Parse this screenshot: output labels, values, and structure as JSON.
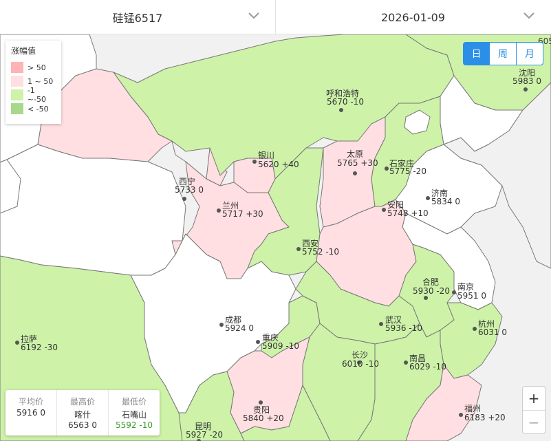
{
  "header": {
    "product": "硅锰6517",
    "date": "2026-01-09"
  },
  "legend": {
    "title": "涨幅值",
    "items": [
      {
        "label": "> 50",
        "color": "#ffb3b5"
      },
      {
        "label": "1 ~ 50",
        "color": "#ffdfe1"
      },
      {
        "label": "-1 ~-50",
        "color": "#cdf2a8"
      },
      {
        "label": "< -50",
        "color": "#a8d98a"
      }
    ]
  },
  "period_buttons": [
    {
      "label": "日",
      "active": true
    },
    {
      "label": "周",
      "active": false
    },
    {
      "label": "月",
      "active": false
    }
  ],
  "stats": {
    "avg": {
      "label": "平均价",
      "value": "5916 0"
    },
    "max": {
      "label": "最高价",
      "city": "喀什",
      "value": "6563 0"
    },
    "min": {
      "label": "最低价",
      "city": "石嘴山",
      "value": "5592 -10"
    }
  },
  "zoom": {
    "in": "+",
    "out": "−"
  },
  "edge_label": "605",
  "cities": [
    {
      "name": "沈阳",
      "value": "5983 0"
    },
    {
      "name": "呼和浩特",
      "value": "5670 -10"
    },
    {
      "name": "银川",
      "value": "5620 +40"
    },
    {
      "name": "太原",
      "value": "5765 +30"
    },
    {
      "name": "石家庄",
      "value": "5775 -20"
    },
    {
      "name": "西宁",
      "value": "5733 0"
    },
    {
      "name": "济南",
      "value": "5834 0"
    },
    {
      "name": "兰州",
      "value": "5717 +30"
    },
    {
      "name": "安阳",
      "value": "5748 +10"
    },
    {
      "name": "西安",
      "value": "5752 -10"
    },
    {
      "name": "合肥",
      "value": "5930 -20"
    },
    {
      "name": "南京",
      "value": "5951 0"
    },
    {
      "name": "成都",
      "value": "5924 0"
    },
    {
      "name": "武汉",
      "value": "5936 -10"
    },
    {
      "name": "杭州",
      "value": "6031 0"
    },
    {
      "name": "拉萨",
      "value": "6192 -30"
    },
    {
      "name": "重庆",
      "value": "5909 -10"
    },
    {
      "name": "长沙",
      "value": "6010 -10"
    },
    {
      "name": "南昌",
      "value": "6029 -10"
    },
    {
      "name": "贵阳",
      "value": "5840 +20"
    },
    {
      "name": "福州",
      "value": "6183 +20"
    },
    {
      "name": "昆明",
      "value": "5927 -20"
    }
  ]
}
